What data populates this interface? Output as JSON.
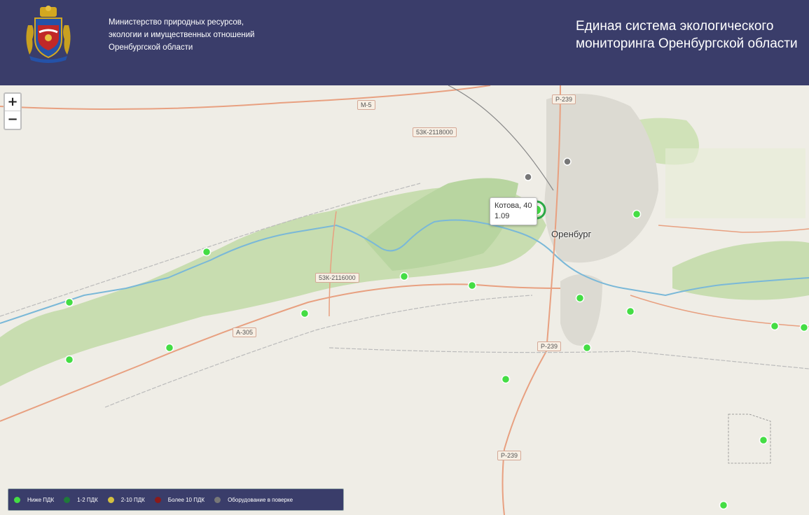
{
  "header": {
    "ministry_line1": "Министерство природных ресурсов,",
    "ministry_line2": "экологии и имущественных отношений",
    "ministry_line3": "Оренбургской области",
    "title_line1": "Единая система экологического",
    "title_line2": "мониторинга Оренбургской области"
  },
  "map": {
    "zoom_in": "+",
    "zoom_out": "−",
    "city": "Оренбург",
    "roads": [
      "М-5",
      "Р-239",
      "53К-2118000",
      "53К-2116000",
      "А-305",
      "Р-239",
      "Р-239"
    ],
    "tooltip": {
      "name": "Котова, 40",
      "value": "1.09"
    }
  },
  "legend": {
    "items": [
      {
        "label": "Ниже ПДК",
        "color": "#44dd44"
      },
      {
        "label": "1-2 ПДК",
        "color": "#1f7a3a"
      },
      {
        "label": "2-10 ПДК",
        "color": "#d4c040"
      },
      {
        "label": "Более 10 ПДК",
        "color": "#8b1a1a"
      },
      {
        "label": "Оборудование в поверке",
        "color": "#777777"
      }
    ]
  },
  "colors": {
    "header_bg": "#3a3d6a",
    "station_green": "#44dd44",
    "station_gray": "#777777"
  }
}
